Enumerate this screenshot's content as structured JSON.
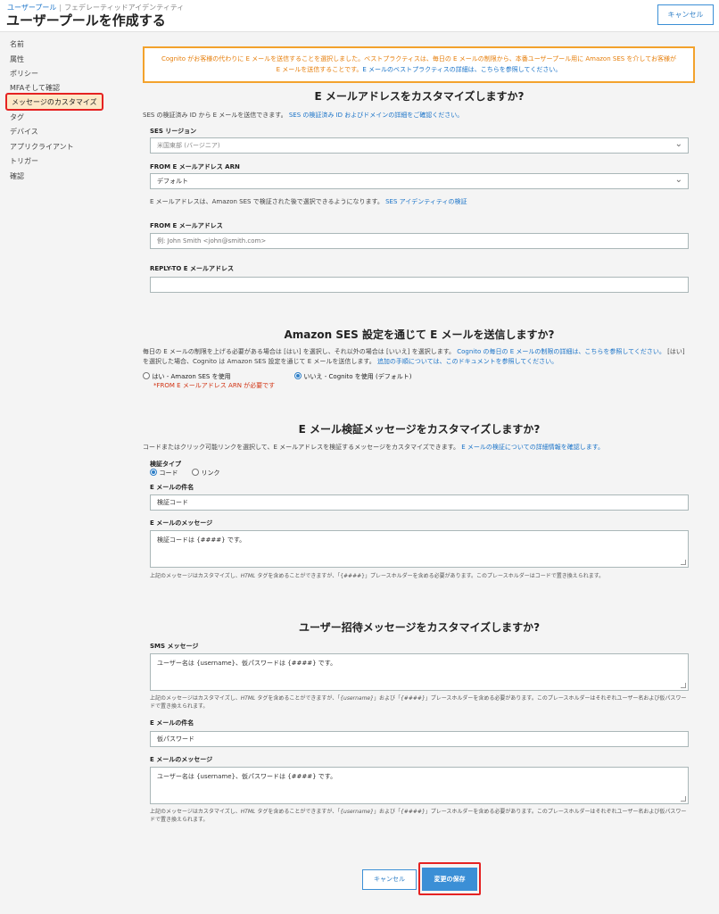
{
  "header": {
    "breadcrumb": [
      "ユーザープール",
      "フェデレーティッドアイデンティティ"
    ],
    "title": "ユーザープールを作成する",
    "cancel_label": "キャンセル"
  },
  "sidebar": {
    "items": [
      {
        "label": "名前"
      },
      {
        "label": "属性"
      },
      {
        "label": "ポリシー"
      },
      {
        "label": "MFAそして確認"
      },
      {
        "label": "メッセージのカスタマイズ",
        "active": true
      },
      {
        "label": "タグ"
      },
      {
        "label": "デバイス"
      },
      {
        "label": "アプリクライアント"
      },
      {
        "label": "トリガー"
      },
      {
        "label": "確認"
      }
    ]
  },
  "notice": {
    "text": "Cognito がお客様の代わりに E メールを送信することを選択しました。ベストプラクティスは、毎日の E メールの制限から、本番ユーザープール用に Amazon SES を介してお客様が E メールを送信することです。",
    "link": "E メールのベストプラクティスの詳細は、こちらを参照してください。"
  },
  "email_section": {
    "title": "E メールアドレスをカスタマイズしますか?",
    "desc": "SES の検証済み ID から E メールを送信できます。",
    "desc_link": "SES の検証済み ID およびドメインの詳細をご確認ください。",
    "ses_region_label": "SES リージョン",
    "ses_region_value": "米国東部 (バージニア)",
    "from_arn_label": "FROM E メールアドレス ARN",
    "from_arn_value": "デフォルト",
    "arn_note": "E メールアドレスは、Amazon SES で検証された後で選択できるようになります。",
    "arn_note_link": "SES アイデンティティの検証",
    "from_email_label": "FROM E メールアドレス",
    "from_email_placeholder": "例: John Smith <john@smith.com>",
    "reply_to_label": "REPLY-TO E メールアドレス",
    "reply_to_value": ""
  },
  "ses_section": {
    "title": "Amazon SES 設定を通じて E メールを送信しますか?",
    "desc": "毎日の E メールの制限を上げる必要がある場合は [はい] を選択し、それ以外の場合は [いいえ] を選択します。",
    "desc_link1": "Cognito の毎日の E メールの制限の詳細は、こちらを参照してください。",
    "desc2": "[はい] を選択した場合、Cognito は Amazon SES 設定を通じて E メールを送信します。",
    "desc_link2": "追加の手順については、このドキュメントを参照してください。",
    "opt_yes": "はい - Amazon SES を使用",
    "opt_yes_warning": "*FROM E メールアドレス ARN が必要です",
    "opt_no": "いいえ - Cognito を使用 (デフォルト)"
  },
  "verify_section": {
    "title": "E メール検証メッセージをカスタマイズしますか?",
    "desc": "コードまたはクリック可能リンクを選択して、E メールアドレスを検証するメッセージをカスタマイズできます。",
    "desc_link": "E メールの検証についての詳細情報を確認します。",
    "type_label": "検証タイプ",
    "opt_code": "コード",
    "opt_link": "リンク",
    "subject_label": "E メールの件名",
    "subject_value": "検証コード",
    "message_label": "E メールのメッセージ",
    "message_value": "検証コードは {####} です。",
    "note_a": "上記のメッセージはカスタマイズし、",
    "note_html": "HTML",
    "note_b": " タグを含めることができますが、「{####}」プレースホルダーを含める必要があります。このプレースホルダーはコードで置き換えられます。"
  },
  "invite_section": {
    "title": "ユーザー招待メッセージをカスタマイズしますか?",
    "sms_label": "SMS メッセージ",
    "sms_value": "ユーザー名は {username}、仮パスワードは {####} です。",
    "note_a": "上記のメッセージはカスタマイズし、",
    "note_html": "HTML",
    "note_b": " タグを含めることができますが、「",
    "note_user": "{username}",
    "note_c": "」および「",
    "note_code": "{####}",
    "note_d": "」プレースホルダーを含める必要があります。このプレースホルダーはそれぞれユーザー名および仮パスワードで置き換えられます。",
    "subject_label": "E メールの件名",
    "subject_value": "仮パスワード",
    "message_label": "E メールのメッセージ",
    "message_value": "ユーザー名は {username}、仮パスワードは {####} です。"
  },
  "footer": {
    "cancel_label": "キャンセル",
    "save_label": "変更の保存"
  }
}
